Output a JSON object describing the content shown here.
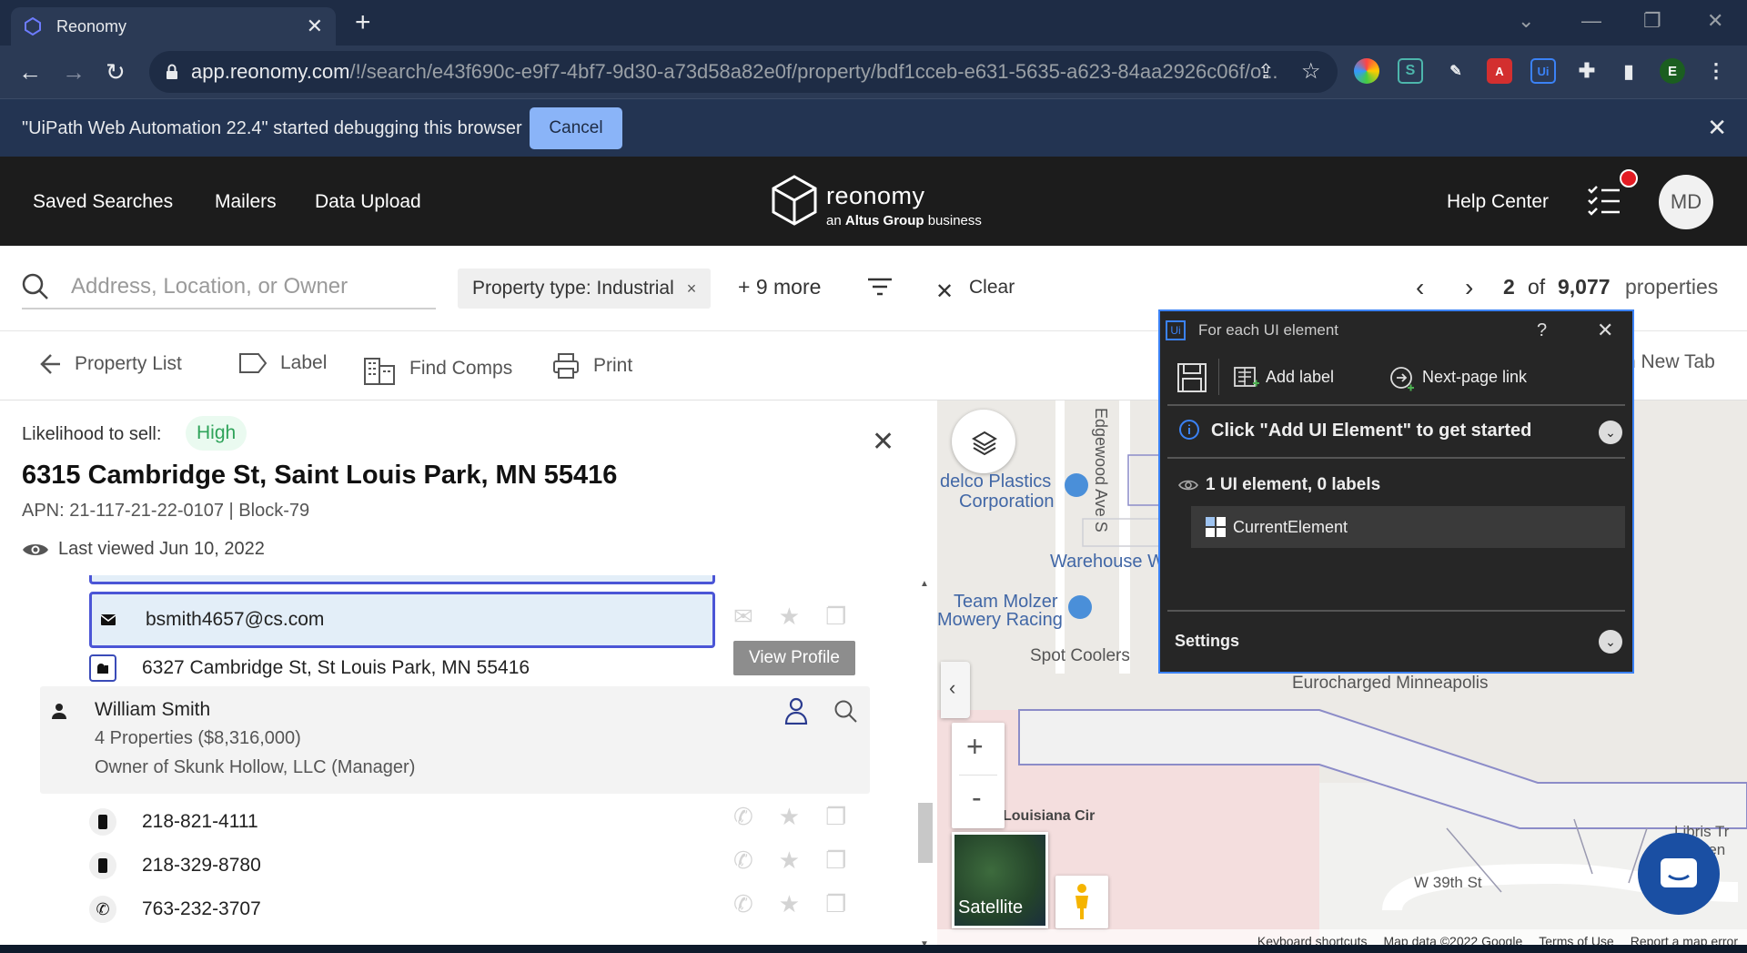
{
  "browser": {
    "tab_title": "Reonomy",
    "url_host": "app.reonomy.com",
    "url_path": "/!/search/e43f690c-e9f7-4bf7-9d30-a73d58a82e0f/property/bdf1cceb-e631-5635-a623-84aa2926c06f/o...",
    "profile_initial": "E"
  },
  "infobar": {
    "message": "\"UiPath Web Automation 22.4\" started debugging this browser",
    "cancel_label": "Cancel"
  },
  "header": {
    "nav": [
      "Saved Searches",
      "Mailers",
      "Data Upload"
    ],
    "logo_word": "reonomy",
    "logo_sub_prefix": "an ",
    "logo_sub_bold": "Altus Group",
    "logo_sub_suffix": " business",
    "help_center": "Help Center",
    "avatar_initials": "MD"
  },
  "search": {
    "placeholder": "Address, Location, or Owner",
    "chip_label": "Property type: Industrial",
    "chip_remove": "×",
    "more_filters": "+ 9 more",
    "clear_label": "Clear",
    "current": "2",
    "of_label": "of",
    "total": "9,077",
    "unit": "properties"
  },
  "toolbar": {
    "property_list": "Property List",
    "label": "Label",
    "find_comps": "Find Comps",
    "print": "Print",
    "new_tab": "n New Tab"
  },
  "property": {
    "likelihood_label": "Likelihood to sell:",
    "likelihood_value": "High",
    "address": "6315 Cambridge St, Saint Louis Park, MN 55416",
    "apn": "APN: 21-117-21-22-0107 | Block-79",
    "last_viewed": "Last viewed Jun 10, 2022"
  },
  "contacts": {
    "email": "bsmith4657@cs.com",
    "mailing_address": "6327 Cambridge St, St Louis Park, MN 55416",
    "view_profile": "View Profile",
    "person": {
      "name": "William Smith",
      "properties": "4 Properties ($8,316,000)",
      "role": "Owner of Skunk Hollow, LLC (Manager)"
    },
    "phones": [
      "218-821-4111",
      "218-329-8780",
      "763-232-3707"
    ]
  },
  "map": {
    "labels": {
      "delco1": "delco Plastics",
      "delco2": "Corporation",
      "edgewood": "Edgewood Ave S",
      "warehouse": "Warehouse W",
      "molzer1": "Team Molzer",
      "molzer2": "Mowery Racing",
      "spot": "Spot Coolers",
      "euro": "Eurocharged Minneapolis",
      "louisiana": "Louisiana Cir",
      "w39": "W 39th St",
      "libris1": "Libris Tr",
      "libris2": "Sen",
      "satellite": "Satellite"
    },
    "zoom_in": "+",
    "zoom_out": "-",
    "attribution": [
      "Keyboard shortcuts",
      "Map data ©2022 Google",
      "Terms of Use",
      "Report a map error"
    ]
  },
  "uipath": {
    "title": "For each UI element",
    "help": "?",
    "add_label": "Add label",
    "next_page": "Next-page link",
    "hint": "Click \"Add UI Element\" to get started",
    "count": "1 UI element, 0 labels",
    "element": "CurrentElement",
    "settings": "Settings"
  },
  "colors": {
    "chrome_dark": "#1e2c45",
    "app_header": "#1c1c1c",
    "selection_border": "#4b55d6",
    "uipath_accent": "#3b82f6",
    "high_green": "#2fa35a"
  }
}
